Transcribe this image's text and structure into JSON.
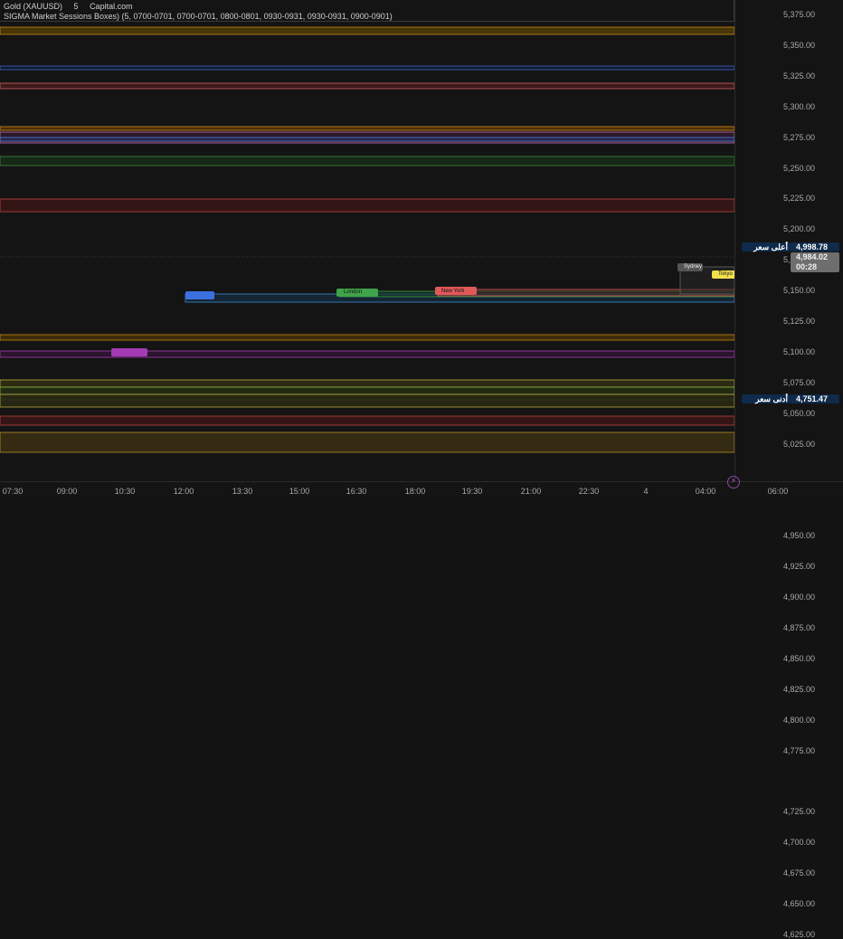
{
  "legend": {
    "line1_symbol": "Gold (XAUUSD)",
    "line1_interval": "5",
    "line1_source": "Capital.com",
    "line2": "SIGMA Market Sessions Boxes) (5, 0700-0701, 0700-0701, 0800-0801, 0930-0931, 0930-0931, 0900-0901)"
  },
  "price_axis": {
    "ticks": [
      "5,375.00",
      "5,350.00",
      "5,325.00",
      "5,300.00",
      "5,275.00",
      "5,250.00",
      "5,225.00",
      "5,200.00",
      "5,175.00",
      "5,150.00",
      "5,125.00",
      "5,100.00",
      "5,075.00",
      "5,050.00",
      "5,025.00",
      "4,950.00",
      "4,925.00",
      "4,900.00",
      "4,875.00",
      "4,850.00",
      "4,825.00",
      "4,800.00",
      "4,775.00",
      "4,725.00",
      "4,700.00",
      "4,675.00",
      "4,650.00",
      "4,625.00"
    ],
    "high_label": "أعلى سعر",
    "high_value": "4,998.78",
    "low_label": "أدنى سعر",
    "low_value": "4,751.47",
    "current_value": "4,984.02",
    "countdown": "00:28"
  },
  "time_axis": {
    "ticks": [
      "07:30",
      "09:00",
      "10:30",
      "12:00",
      "13:30",
      "15:00",
      "16:30",
      "18:00",
      "19:30",
      "21:00",
      "22:30",
      "4",
      "04:00",
      "06:00"
    ]
  },
  "session_labels": [
    {
      "text": "",
      "color": "#3c6fe0"
    },
    {
      "text": "",
      "color": "#a43bb5"
    },
    {
      "text": "London",
      "color": "#3fa34a"
    },
    {
      "text": "New York",
      "color": "#e05a5a"
    },
    {
      "text": "Sydney",
      "color": "#555555"
    },
    {
      "text": "Tokyo",
      "color": "#f0e04a"
    }
  ],
  "colors": {
    "background": "#141414",
    "candle_up": "#e6e6e6",
    "candle_down": "#9a9a9a",
    "high_tag_bg": "#0f2a4a"
  },
  "icons": {
    "watermark": "tradingview-logo-icon"
  }
}
